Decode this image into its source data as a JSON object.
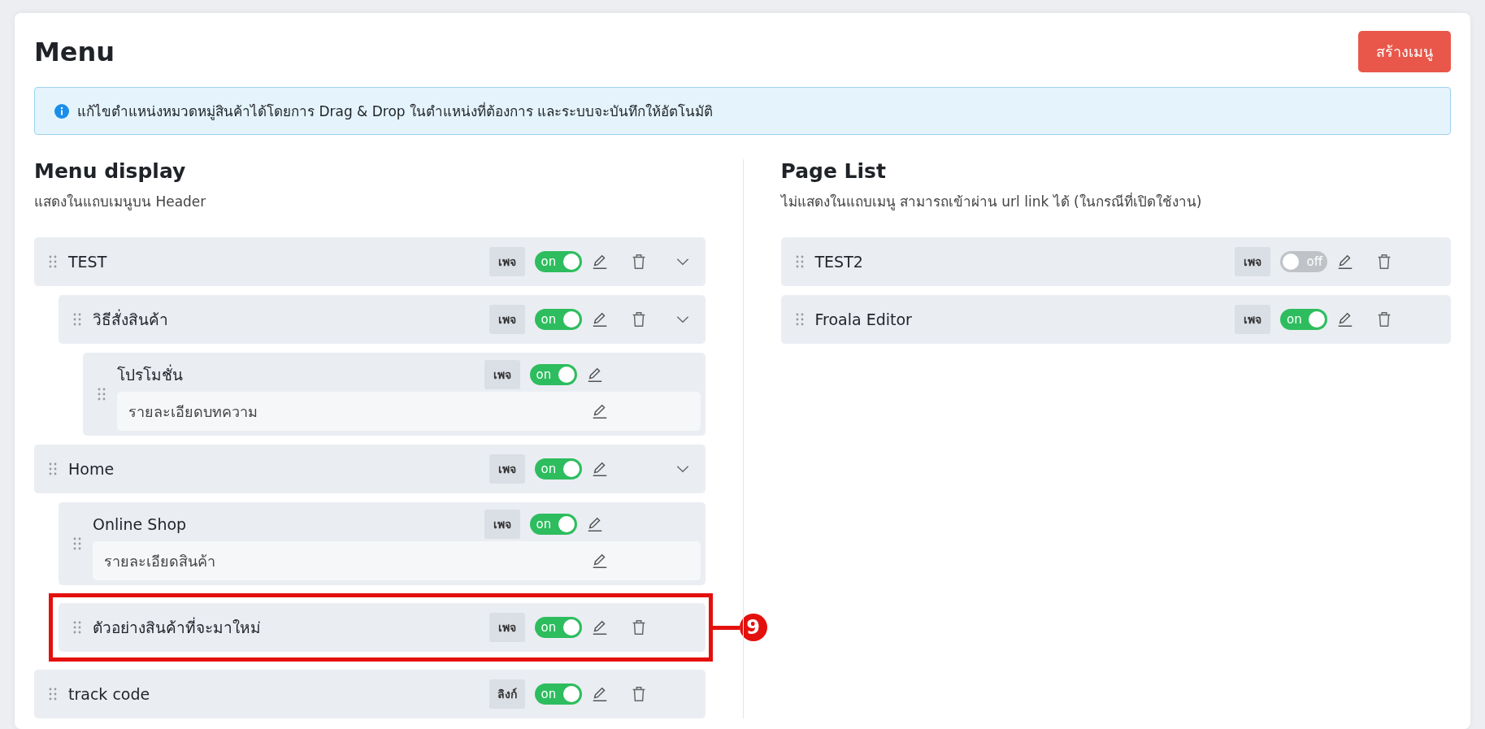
{
  "page": {
    "title": "Menu",
    "create_button": "สร้างเมนู"
  },
  "notice": "แก้ไขตำแหน่งหมวดหมู่สินค้าได้โดยการ Drag & Drop ในตำแหน่งที่ต้องการ และระบบจะบันทึกให้อัตโนมัติ",
  "menu_display": {
    "title": "Menu display",
    "subtitle": "แสดงในแถบเมนูบน Header",
    "items": [
      {
        "label": "TEST",
        "badge": "เพจ",
        "switch": {
          "on": true,
          "label": "on"
        },
        "deletable": true,
        "expanded": true,
        "children": [
          {
            "label": "วิธีสั่งสินค้า",
            "badge": "เพจ",
            "switch": {
              "on": true,
              "label": "on"
            },
            "deletable": true,
            "expanded": true,
            "children": [
              {
                "label": "โปรโมชั่น",
                "badge": "เพจ",
                "switch": {
                  "on": true,
                  "label": "on"
                },
                "deletable": false,
                "detail": "รายละเอียดบทความ"
              }
            ]
          }
        ]
      },
      {
        "label": "Home",
        "badge": "เพจ",
        "switch": {
          "on": true,
          "label": "on"
        },
        "deletable": false,
        "expanded": true,
        "children": [
          {
            "label": "Online Shop",
            "badge": "เพจ",
            "switch": {
              "on": true,
              "label": "on"
            },
            "deletable": false,
            "detail": "รายละเอียดสินค้า"
          },
          {
            "label": "ตัวอย่างสินค้าที่จะมาใหม่",
            "badge": "เพจ",
            "switch": {
              "on": true,
              "label": "on"
            },
            "deletable": true,
            "callout": "9"
          }
        ]
      },
      {
        "label": "track code",
        "badge": "ลิงก์",
        "switch": {
          "on": true,
          "label": "on"
        },
        "deletable": true
      }
    ]
  },
  "page_list": {
    "title": "Page List",
    "subtitle": "ไม่แสดงในแถบเมนู สามารถเข้าผ่าน url link ได้ (ในกรณีที่เปิดใช้งาน)",
    "items": [
      {
        "label": "TEST2",
        "badge": "เพจ",
        "switch": {
          "on": false,
          "label": "off"
        },
        "deletable": true
      },
      {
        "label": "Froala Editor",
        "badge": "เพจ",
        "switch": {
          "on": true,
          "label": "on"
        },
        "deletable": true
      }
    ]
  }
}
